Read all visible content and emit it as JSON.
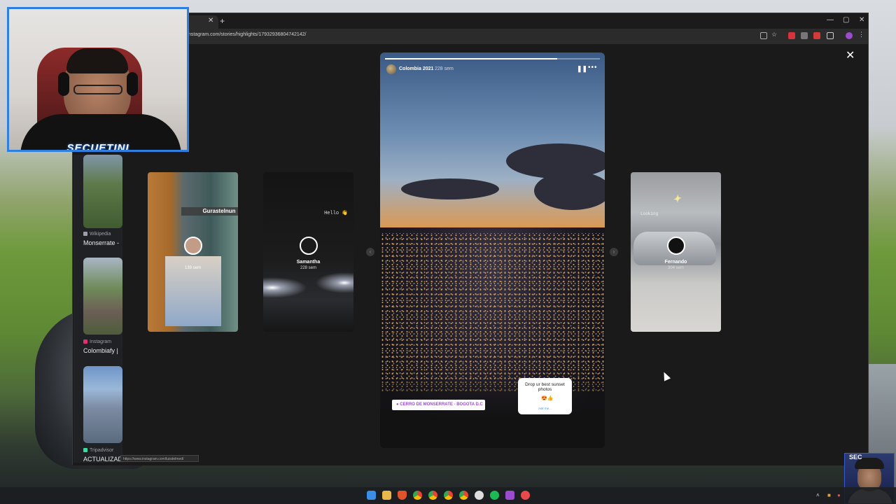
{
  "browser": {
    "url": "nstagram.com/stories/highlights/17932936804742142/",
    "status_url": "https://www.instagram.com/luisdelmed/"
  },
  "side_results": [
    {
      "source": "Wikipedia",
      "title": "Monserrate -",
      "color": "#9aa0a6"
    },
    {
      "source": "Instagram",
      "title": "Colombiafy |",
      "color": "#e1306c"
    },
    {
      "source": "Tripadvisor",
      "title": "ACTUALIZADO",
      "color": "#34e0a1"
    }
  ],
  "cards": [
    {
      "label": "Gurastelnun",
      "name": "",
      "time": "139 sem"
    },
    {
      "label": "Hello 👋",
      "name": "Samantha",
      "time": "228 sem"
    },
    {
      "label": "Looking",
      "name": "Fernando",
      "time": "304 sem"
    }
  ],
  "story": {
    "title": "Colombia 2021",
    "time": "228 sem",
    "progress": 0.8,
    "location": "CERRO DE MONSERRATE - BOGOTA D.C",
    "question": "Drop ur best sunset photos",
    "question_emoji": "😍👍",
    "reply": "Ask me..."
  },
  "webcam": {
    "label": "SECUETINI"
  },
  "webcam_small": {
    "label": "SEC"
  },
  "icons": {
    "close": "✕",
    "pause": "❚❚",
    "more": "•••",
    "arrow_left": "‹",
    "arrow_right": "›",
    "location": "●"
  },
  "colors": {
    "accent": "#2f7fe0",
    "instagram": "#e1306c"
  }
}
